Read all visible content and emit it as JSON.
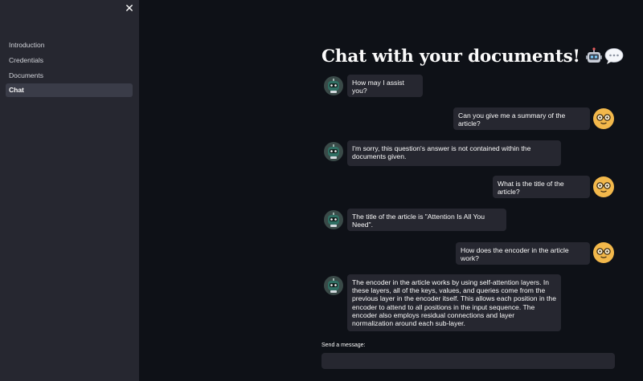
{
  "sidebar": {
    "close_icon": "✕",
    "items": [
      {
        "label": "Introduction",
        "active": false
      },
      {
        "label": "Credentials",
        "active": false
      },
      {
        "label": "Documents",
        "active": false
      },
      {
        "label": "Chat",
        "active": true
      }
    ]
  },
  "main": {
    "title": "Chat with your documents!",
    "title_icons": [
      "robot-icon",
      "speech-bubble-icon"
    ]
  },
  "messages": [
    {
      "role": "assistant",
      "text": "How may I assist you?"
    },
    {
      "role": "user",
      "text": "Can you give me a summary of the article?"
    },
    {
      "role": "assistant",
      "text": "I'm sorry, this question's answer is not contained within the documents given."
    },
    {
      "role": "user",
      "text": "What is the title of the article?"
    },
    {
      "role": "assistant",
      "text": "The title of the article is \"Attention Is All You Need\"."
    },
    {
      "role": "user",
      "text": "How does the encoder in the article work?"
    },
    {
      "role": "assistant",
      "text": "The encoder in the article works by using self-attention layers. In these layers, all of the keys, values, and queries come from the previous layer in the encoder itself. This allows each position in the encoder to attend to all positions in the input sequence. The encoder also employs residual connections and layer normalization around each sub-layer."
    }
  ],
  "input": {
    "label": "Send a message:",
    "value": ""
  },
  "colors": {
    "background": "#0e1117",
    "sidebar": "#262730",
    "bubble": "#262730",
    "user_avatar": "#f2b84b",
    "bot_avatar": "#2f6f63"
  }
}
